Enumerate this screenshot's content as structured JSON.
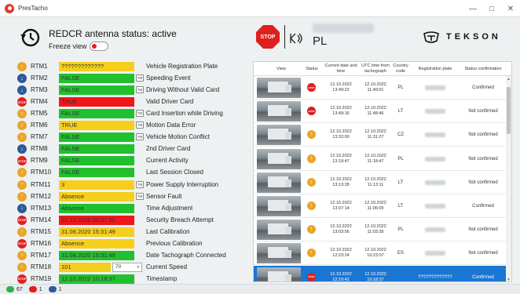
{
  "window": {
    "title": "PresTacho",
    "controls": {
      "minimize": "—",
      "maximize": "□",
      "close": "✕"
    }
  },
  "header": {
    "antenna_status": "REDCR antenna status: active",
    "freeze_label": "Freeze view",
    "stop_text": "STOP",
    "country": "PL",
    "brand": "TEKSON"
  },
  "rtm": [
    {
      "id": "RTM1",
      "icon": "up",
      "value": "?????????????",
      "color": "yellow",
      "tag": false,
      "select": null,
      "desc": "Vehicle Registration Plate"
    },
    {
      "id": "RTM2",
      "icon": "down",
      "value": "FALSE",
      "color": "green",
      "tag": true,
      "select": null,
      "desc": "Speeding Event"
    },
    {
      "id": "RTM3",
      "icon": "down",
      "value": "FALSE",
      "color": "green",
      "tag": true,
      "select": null,
      "desc": "Driving Without Valid Card"
    },
    {
      "id": "RTM4",
      "icon": "stop",
      "value": "TRUE",
      "color": "red",
      "tag": false,
      "select": null,
      "desc": "Valid Driver Card"
    },
    {
      "id": "RTM5",
      "icon": "up",
      "value": "FALSE",
      "color": "green",
      "tag": true,
      "select": null,
      "desc": "Card Insertion while Driving"
    },
    {
      "id": "RTM6",
      "icon": "up",
      "value": "TRUE",
      "color": "yellow",
      "tag": true,
      "select": null,
      "desc": "Motion Data Error"
    },
    {
      "id": "RTM7",
      "icon": "up",
      "value": "FALSE",
      "color": "green",
      "tag": true,
      "select": null,
      "desc": "Vehicle Motion Conflict"
    },
    {
      "id": "RTM8",
      "icon": "down",
      "value": "FALSE",
      "color": "green",
      "tag": false,
      "select": null,
      "desc": "2nd Driver Card"
    },
    {
      "id": "RTM9",
      "icon": "stop",
      "value": "FALSE",
      "color": "green",
      "tag": false,
      "select": null,
      "desc": "Current Activity"
    },
    {
      "id": "RTM10",
      "icon": "up",
      "value": "FALSE",
      "color": "green",
      "tag": false,
      "select": null,
      "desc": "Last Session Closed"
    },
    {
      "id": "RTM11",
      "icon": "up",
      "value": "3",
      "color": "yellow",
      "tag": true,
      "select": null,
      "desc": "Power Supply Interruption"
    },
    {
      "id": "RTM12",
      "icon": "up",
      "value": "Absence",
      "color": "yellow",
      "tag": true,
      "select": null,
      "desc": "Sensor Fault"
    },
    {
      "id": "RTM13",
      "icon": "down",
      "value": "Absence",
      "color": "green",
      "tag": false,
      "select": null,
      "desc": "Time Adjustment"
    },
    {
      "id": "RTM14",
      "icon": "stop",
      "value": "22.10.2020 09:07:35",
      "color": "red",
      "tag": false,
      "select": null,
      "desc": "Security Breach Attempt"
    },
    {
      "id": "RTM15",
      "icon": "up",
      "value": "31.08.2020 15:31:49",
      "color": "yellow",
      "tag": false,
      "select": null,
      "desc": "Last Calibration"
    },
    {
      "id": "RTM16",
      "icon": "stop",
      "value": "Absence",
      "color": "yellow",
      "tag": false,
      "select": null,
      "desc": "Previous Calibration"
    },
    {
      "id": "RTM17",
      "icon": "up",
      "value": "31.08.2020 15:31:49",
      "color": "green",
      "tag": false,
      "select": null,
      "desc": "Date Tachograph Connected"
    },
    {
      "id": "RTM18",
      "icon": "up",
      "value": "101",
      "color": "yellow",
      "tag": false,
      "select": "70",
      "desc": "Current Speed"
    },
    {
      "id": "RTM19",
      "icon": "stop",
      "value": "12.10.2022 10:18:37",
      "color": "green",
      "tag": false,
      "select": null,
      "desc": "Timestamp"
    }
  ],
  "rtm_tag_text": "TM",
  "table": {
    "headers": {
      "view": "View",
      "status": "Status",
      "current": "Current date and time",
      "utc": "UTC time from tachograph",
      "country": "Country code",
      "plate": "Registration plate",
      "confirm": "Status confirmation"
    },
    "rows": [
      {
        "status": "stop",
        "date": "12.10.2022",
        "time": "13:49:22",
        "utc_date": "12.10.2022",
        "utc_time": "11:49:01",
        "country": "PL",
        "plate": "",
        "confirm": "Confirmed",
        "selected": false
      },
      {
        "status": "stop",
        "date": "12.10.2022",
        "time": "13:49:16",
        "utc_date": "12.10.2022",
        "utc_time": "11:48:46",
        "country": "LT",
        "plate": "",
        "confirm": "Not confirmed",
        "selected": false
      },
      {
        "status": "up",
        "date": "12.10.2022",
        "time": "13:32:00",
        "utc_date": "12.10.2022",
        "utc_time": "11:31:27",
        "country": "CZ",
        "plate": "",
        "confirm": "Not confirmed",
        "selected": false
      },
      {
        "status": "up",
        "date": "12.10.2022",
        "time": "13:19:47",
        "utc_date": "12.10.2022",
        "utc_time": "11:18:47",
        "country": "PL",
        "plate": "",
        "confirm": "Not confirmed",
        "selected": false
      },
      {
        "status": "up",
        "date": "12.10.2022",
        "time": "13:13:28",
        "utc_date": "12.10.2022",
        "utc_time": "11:13:11",
        "country": "LT",
        "plate": "",
        "confirm": "Not confirmed",
        "selected": false
      },
      {
        "status": "up",
        "date": "12.10.2022",
        "time": "13:07:14",
        "utc_date": "12.10.2022",
        "utc_time": "11:06:09",
        "country": "LT",
        "plate": "",
        "confirm": "Confirmed",
        "selected": false
      },
      {
        "status": "up",
        "date": "12.10.2022",
        "time": "13:03:56",
        "utc_date": "12.10.2022",
        "utc_time": "11:03:39",
        "country": "PL",
        "plate": "",
        "confirm": "Not confirmed",
        "selected": false
      },
      {
        "status": "up",
        "date": "12.10.2022",
        "time": "12:23:24",
        "utc_date": "12.10.2022",
        "utc_time": "10:23:07",
        "country": "ES",
        "plate": "",
        "confirm": "Not confirmed",
        "selected": false
      },
      {
        "status": "stop",
        "date": "12.10.2022",
        "time": "12:19:42",
        "utc_date": "12.10.2022",
        "utc_time": "10:18:37",
        "country": "",
        "plate": "?????????????",
        "confirm": "Confirmed",
        "selected": true
      }
    ]
  },
  "footer": {
    "green_count": "67",
    "red_count": "1",
    "blue_count": "1"
  }
}
